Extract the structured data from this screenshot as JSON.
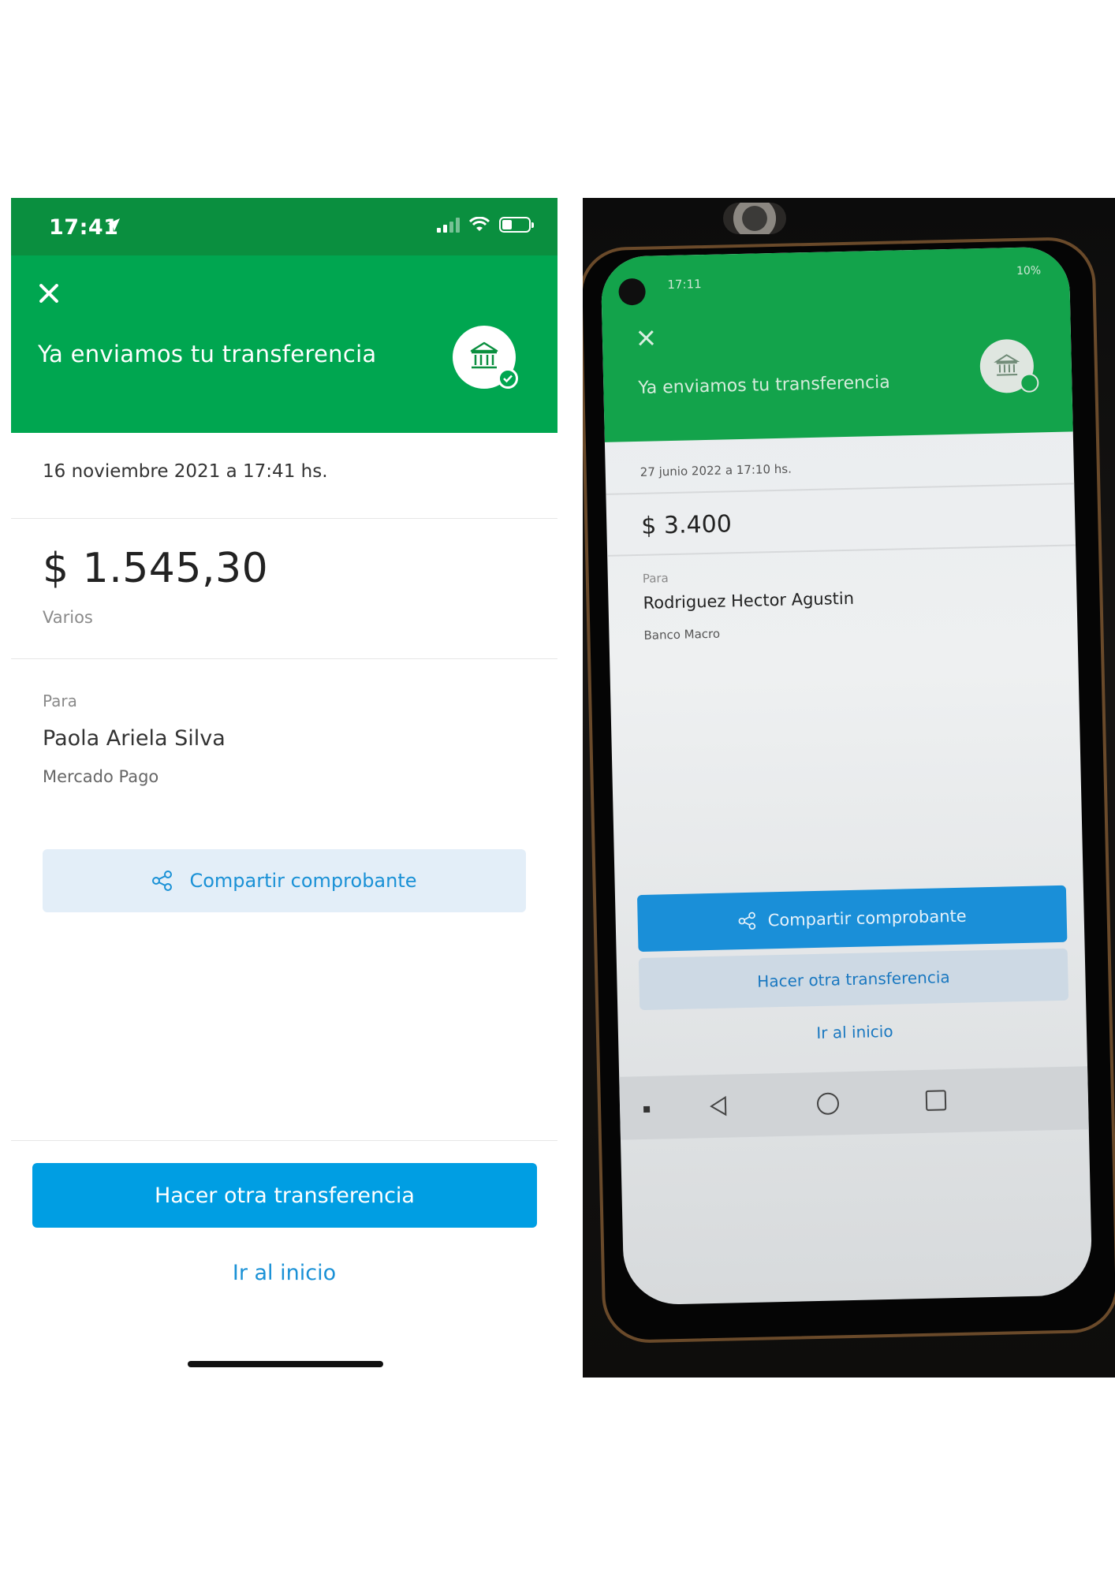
{
  "left": {
    "status_bar": {
      "time": "17:41"
    },
    "header": {
      "title": "Ya enviamos tu transferencia",
      "icons": [
        "close-icon",
        "bank-icon",
        "check-icon"
      ]
    },
    "date": "16 noviembre 2021 a 17:41 hs.",
    "amount": "$ 1.545,30",
    "concept": "Varios",
    "recipient": {
      "label": "Para",
      "name": "Paola Ariela Silva",
      "bank": "Mercado Pago"
    },
    "share_button": "Compartir comprobante",
    "primary_button": "Hacer otra transferencia",
    "home_link": "Ir al inicio",
    "colors": {
      "status_green": "#0a8f3f",
      "header_green": "#00a650",
      "blue": "#009ee3"
    }
  },
  "right": {
    "status_bar": {
      "time": "17:11",
      "battery": "10%"
    },
    "header": {
      "title": "Ya enviamos tu transferencia"
    },
    "date": "27 junio 2022 a 17:10 hs.",
    "amount": "$ 3.400",
    "recipient": {
      "label": "Para",
      "name": "Rodriguez Hector Agustin",
      "bank": "Banco Macro"
    },
    "share_button": "Compartir comprobante",
    "another_button": "Hacer otra transferencia",
    "home_link": "Ir al inicio"
  }
}
